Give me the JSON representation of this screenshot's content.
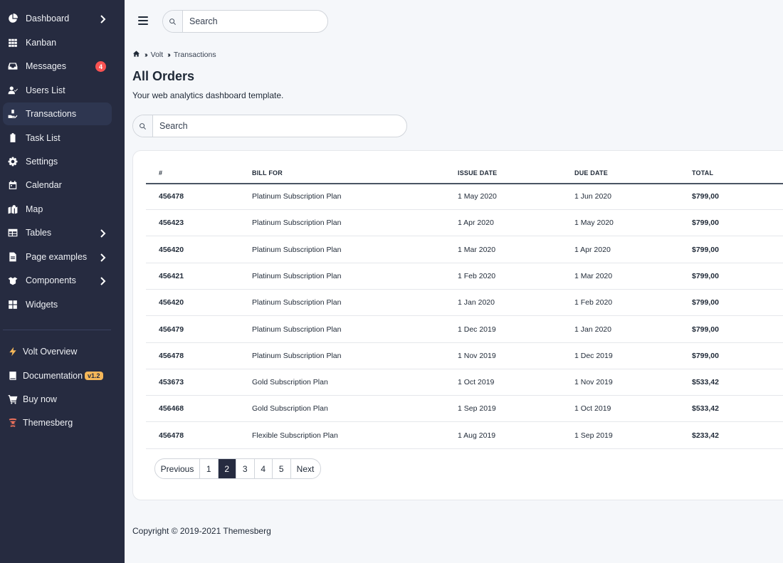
{
  "sidebar": {
    "items": [
      {
        "label": "Dashboard",
        "icon": "chart-pie-icon",
        "chevron": true
      },
      {
        "label": "Kanban",
        "icon": "grid-icon",
        "chevron": false
      },
      {
        "label": "Messages",
        "icon": "inbox-icon",
        "chevron": false,
        "badge": "4"
      },
      {
        "label": "Users List",
        "icon": "user-check-icon",
        "chevron": false
      },
      {
        "label": "Transactions",
        "icon": "hand-coin-icon",
        "chevron": false,
        "active": true
      },
      {
        "label": "Task List",
        "icon": "clipboard-icon",
        "chevron": false
      },
      {
        "label": "Settings",
        "icon": "gear-icon",
        "chevron": false
      },
      {
        "label": "Calendar",
        "icon": "calendar-icon",
        "chevron": false
      },
      {
        "label": "Map",
        "icon": "map-icon",
        "chevron": false
      },
      {
        "label": "Tables",
        "icon": "table-icon",
        "chevron": true
      },
      {
        "label": "Page examples",
        "icon": "file-icon",
        "chevron": true
      },
      {
        "label": "Components",
        "icon": "box-icon",
        "chevron": true
      },
      {
        "label": "Widgets",
        "icon": "widgets-icon",
        "chevron": false
      }
    ],
    "secondary": [
      {
        "label": "Volt Overview",
        "icon": "bolt-icon"
      },
      {
        "label": "Documentation",
        "icon": "book-icon",
        "badge": "v1.2"
      },
      {
        "label": "Buy now",
        "icon": "cart-icon"
      },
      {
        "label": "Themesberg",
        "icon": "themesberg-logo-icon"
      }
    ]
  },
  "topbar": {
    "search_placeholder": "Search"
  },
  "breadcrumb": [
    "Volt",
    "Transactions"
  ],
  "page": {
    "title": "All Orders",
    "subtitle": "Your web analytics dashboard template.",
    "search_placeholder": "Search"
  },
  "table": {
    "headers": [
      "#",
      "BILL FOR",
      "ISSUE DATE",
      "DUE DATE",
      "TOTAL"
    ],
    "rows": [
      [
        "456478",
        "Platinum Subscription Plan",
        "1 May 2020",
        "1 Jun 2020",
        "$799,00"
      ],
      [
        "456423",
        "Platinum Subscription Plan",
        "1 Apr 2020",
        "1 May 2020",
        "$799,00"
      ],
      [
        "456420",
        "Platinum Subscription Plan",
        "1 Mar 2020",
        "1 Apr 2020",
        "$799,00"
      ],
      [
        "456421",
        "Platinum Subscription Plan",
        "1 Feb 2020",
        "1 Mar 2020",
        "$799,00"
      ],
      [
        "456420",
        "Platinum Subscription Plan",
        "1 Jan 2020",
        "1 Feb 2020",
        "$799,00"
      ],
      [
        "456479",
        "Platinum Subscription Plan",
        "1 Dec 2019",
        "1 Jan 2020",
        "$799,00"
      ],
      [
        "456478",
        "Platinum Subscription Plan",
        "1 Nov 2019",
        "1 Dec 2019",
        "$799,00"
      ],
      [
        "453673",
        "Gold Subscription Plan",
        "1 Oct 2019",
        "1 Nov 2019",
        "$533,42"
      ],
      [
        "456468",
        "Gold Subscription Plan",
        "1 Sep 2019",
        "1 Oct 2019",
        "$533,42"
      ],
      [
        "456478",
        "Flexible Subscription Plan",
        "1 Aug 2019",
        "1 Sep 2019",
        "$233,42"
      ]
    ]
  },
  "pagination": {
    "prev": "Previous",
    "pages": [
      "1",
      "2",
      "3",
      "4",
      "5"
    ],
    "active": "2",
    "next": "Next"
  },
  "footer": {
    "copyright": "Copyright © 2019-2021 Themesberg"
  },
  "colors": {
    "sidebar_bg": "#262b40",
    "active_item_bg": "#2e3650",
    "badge_red": "#fa5252",
    "badge_version": "#f5b759",
    "page_bg": "#f5f7fa"
  }
}
